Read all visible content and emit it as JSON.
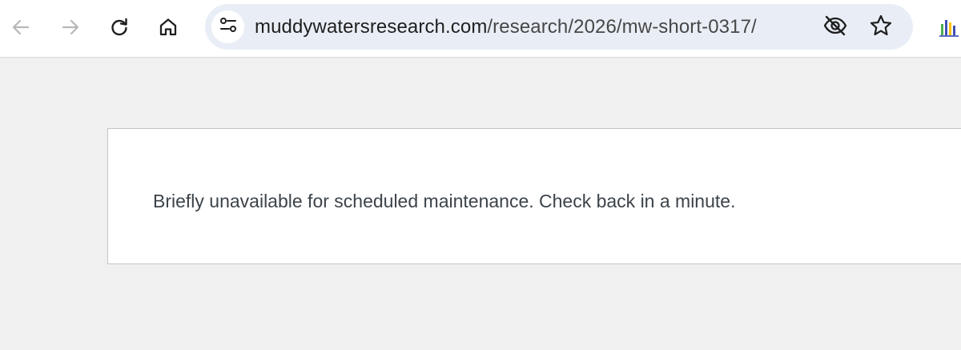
{
  "browser": {
    "address_bar": {
      "host": "muddywatersresearch.com",
      "path": "/research/2026/mw-short-0317/"
    },
    "icons": {
      "back": "arrow-left-icon",
      "forward": "arrow-right-icon",
      "reload": "reload-icon",
      "home": "home-icon",
      "site_info": "tune-icon",
      "tracking": "eye-slash-icon",
      "bookmark": "star-icon",
      "extension": "extension-chart-icon"
    },
    "colors": {
      "toolbar_bg": "#ffffff",
      "omnibox_bg": "#e9eef6",
      "page_bg": "#f0f0f1"
    }
  },
  "page": {
    "message": "Briefly unavailable for scheduled maintenance. Check back in a minute."
  }
}
